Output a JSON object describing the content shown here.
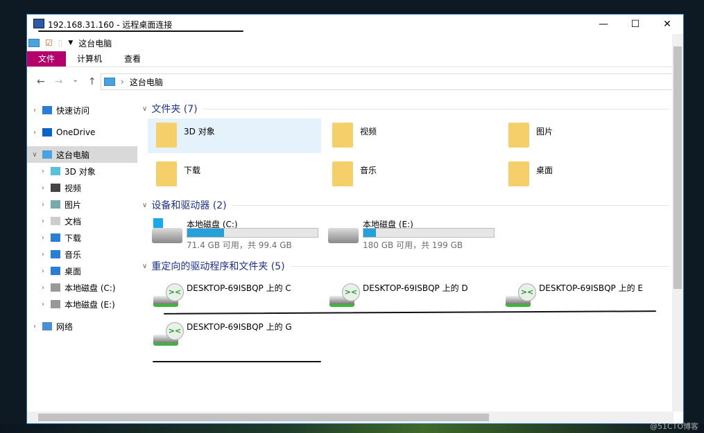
{
  "window": {
    "title": "192.168.31.160 - 远程桌面连接",
    "controls": [
      "—",
      "☐",
      "✕"
    ]
  },
  "qat": {
    "location": "这台电脑"
  },
  "ribbon": {
    "tabs": [
      "文件",
      "计算机",
      "查看"
    ]
  },
  "address": {
    "path": "这台电脑",
    "back": "←",
    "forward": "→",
    "recent": "⌄",
    "up": "↑"
  },
  "tree": [
    {
      "label": "快速访问",
      "icon": "star-icon",
      "level": 0
    },
    {
      "label": "OneDrive",
      "icon": "cloud-icon",
      "level": 0
    },
    {
      "label": "这台电脑",
      "icon": "computer-icon",
      "level": 0,
      "selected": true,
      "expanded": true
    },
    {
      "label": "3D 对象",
      "icon": "cube-icon",
      "level": 1
    },
    {
      "label": "视频",
      "icon": "video-icon",
      "level": 1
    },
    {
      "label": "图片",
      "icon": "picture-icon",
      "level": 1
    },
    {
      "label": "文档",
      "icon": "document-icon",
      "level": 1
    },
    {
      "label": "下载",
      "icon": "download-icon",
      "level": 1
    },
    {
      "label": "音乐",
      "icon": "music-icon",
      "level": 1
    },
    {
      "label": "桌面",
      "icon": "desktop-icon",
      "level": 1
    },
    {
      "label": "本地磁盘 (C:)",
      "icon": "drive-icon",
      "level": 1
    },
    {
      "label": "本地磁盘 (E:)",
      "icon": "drive-icon",
      "level": 1
    },
    {
      "label": "网络",
      "icon": "network-icon",
      "level": 0
    }
  ],
  "groups": {
    "folders": "文件夹 (7)",
    "drives": "设备和驱动器 (2)",
    "redirected": "重定向的驱动程序和文件夹 (5)"
  },
  "folders": [
    {
      "label": "3D 对象",
      "selected": true
    },
    {
      "label": "视频"
    },
    {
      "label": "图片"
    },
    {
      "label": "下载"
    },
    {
      "label": "音乐"
    },
    {
      "label": "桌面"
    }
  ],
  "drives": [
    {
      "label": "本地磁盘 (C:)",
      "space": "71.4 GB 可用，共 99.4 GB",
      "used_percent": 28.2
    },
    {
      "label": "本地磁盘 (E:)",
      "space": "180 GB 可用，共 199 GB",
      "used_percent": 9.5
    }
  ],
  "redirected": [
    {
      "label": "DESKTOP-69ISBQP 上的 C"
    },
    {
      "label": "DESKTOP-69ISBQP 上的 D"
    },
    {
      "label": "DESKTOP-69ISBQP 上的 E"
    },
    {
      "label": "DESKTOP-69ISBQP 上的 G"
    }
  ],
  "watermark": "@51CTO博客",
  "colors": {
    "file_tab": "#b3006b",
    "accent": "#26a0da",
    "group_header": "#1e3287"
  }
}
